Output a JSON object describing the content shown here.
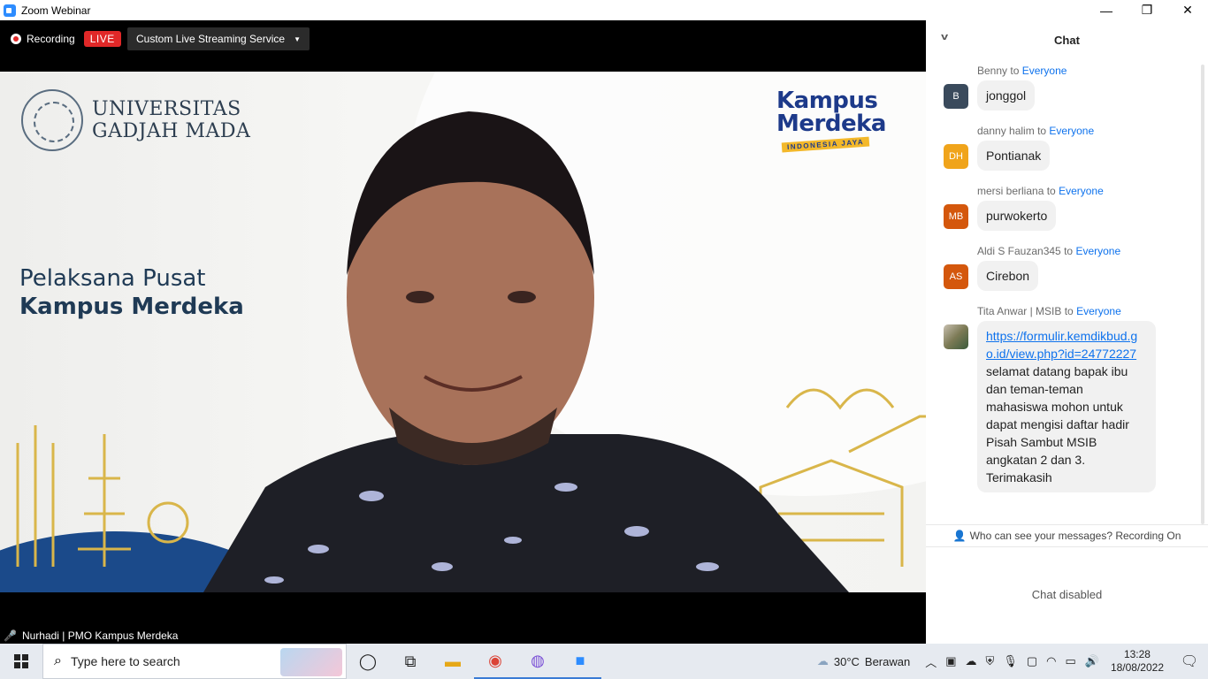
{
  "window": {
    "title": "Zoom Webinar",
    "minimize": "—",
    "restore": "❐",
    "close": "✕"
  },
  "topbar": {
    "recording_label": "Recording",
    "live_badge": "LIVE",
    "stream_service": "Custom Live Streaming Service"
  },
  "video": {
    "university_line1": "UNIVERSITAS",
    "university_line2": "GADJAH MADA",
    "kampus_line1": "Kampus",
    "kampus_line2": "Merdeka",
    "kampus_tag": "INDONESIA JAYA",
    "headline_line1": "Pelaksana Pusat",
    "headline_line2": "Kampus Merdeka",
    "speaker_name": "Nurhadi | PMO Kampus Merdeka"
  },
  "chat": {
    "title": "Chat",
    "messages": [
      {
        "sender": "Benny",
        "to_word": "to",
        "recipient": "Everyone",
        "avatar_initials": "B",
        "avatar_color": "#3a4a5c",
        "text": "jonggol"
      },
      {
        "sender": "danny halim",
        "to_word": "to",
        "recipient": "Everyone",
        "avatar_initials": "DH",
        "avatar_color": "#f0a41b",
        "text": "Pontianak"
      },
      {
        "sender": "mersi berliana",
        "to_word": "to",
        "recipient": "Everyone",
        "avatar_initials": "MB",
        "avatar_color": "#d4570c",
        "text": "purwokerto"
      },
      {
        "sender": "Aldi S Fauzan345",
        "to_word": "to",
        "recipient": "Everyone",
        "avatar_initials": "AS",
        "avatar_color": "#d4570c",
        "text": "Cirebon"
      },
      {
        "sender": "Tita Anwar | MSIB",
        "to_word": "to",
        "recipient": "Everyone",
        "avatar_initials": "",
        "link": "https://formulir.kemdikbud.go.id/view.php?id=24772227",
        "text": " selamat datang bapak ibu dan teman-teman mahasiswa mohon untuk dapat mengisi daftar hadir Pisah Sambut MSIB angkatan 2 dan 3. Terimakasih"
      }
    ],
    "who_can_see": "Who can see your messages? Recording On",
    "disabled_text": "Chat disabled"
  },
  "taskbar": {
    "search_placeholder": "Type here to search",
    "weather_temp": "30°C",
    "weather_text": "Berawan",
    "time": "13:28",
    "date": "18/08/2022"
  }
}
